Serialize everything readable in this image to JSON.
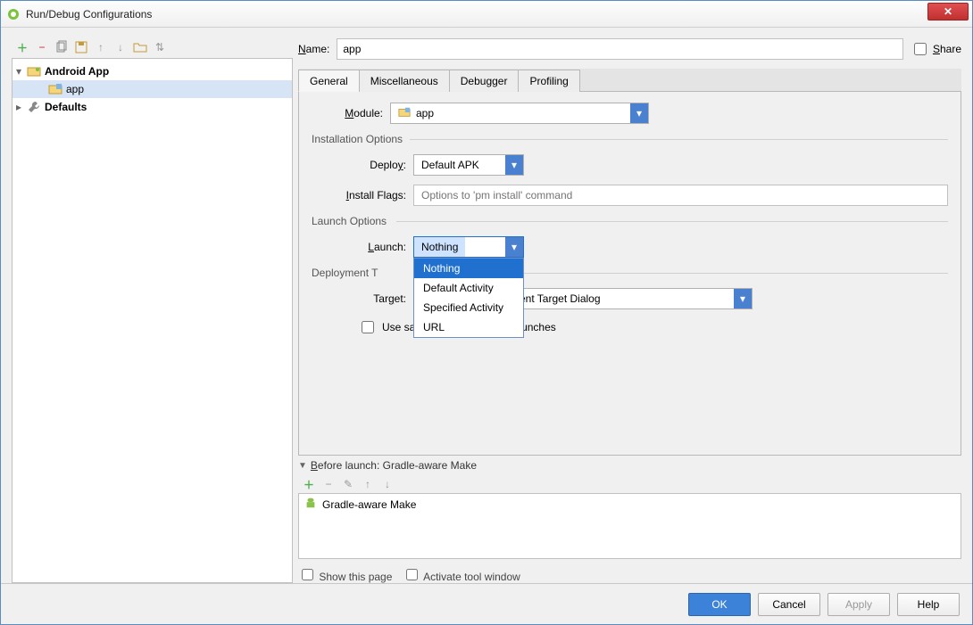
{
  "window": {
    "title": "Run/Debug Configurations"
  },
  "toolbar_icons": [
    "add",
    "remove",
    "copy",
    "save",
    "up",
    "down",
    "folder",
    "sort"
  ],
  "tree": {
    "nodes": [
      {
        "label": "Android App",
        "depth": 0,
        "bold": true,
        "expander": "▾",
        "icon": "android-app"
      },
      {
        "label": "app",
        "depth": 1,
        "bold": false,
        "expander": "",
        "icon": "module"
      },
      {
        "label": "Defaults",
        "depth": 0,
        "bold": true,
        "expander": "▸",
        "icon": "wrench"
      }
    ]
  },
  "name": {
    "label": "Name:",
    "value": "app"
  },
  "share_label": "Share",
  "tabs": [
    "General",
    "Miscellaneous",
    "Debugger",
    "Profiling"
  ],
  "module": {
    "label": "Module:",
    "value": "app"
  },
  "install": {
    "section_label": "Installation Options",
    "deploy_label": "Deploy:",
    "deploy_value": "Default APK",
    "flags_label": "Install Flags:",
    "flags_placeholder": "Options to 'pm install' command"
  },
  "launch": {
    "section_label": "Launch Options",
    "label": "Launch:",
    "value": "Nothing",
    "options": [
      "Nothing",
      "Default Activity",
      "Specified Activity",
      "URL"
    ]
  },
  "deploy_target": {
    "section_label": "Deployment Target Options",
    "target_label": "Target:",
    "target_value_suffix": "ent Target Dialog",
    "same_device_label": "Use same device for future launches"
  },
  "before_launch": {
    "header": "Before launch: Gradle-aware Make",
    "item": "Gradle-aware Make"
  },
  "bottom": {
    "show_page": "Show this page",
    "activate_tool": "Activate tool window"
  },
  "buttons": {
    "ok": "OK",
    "cancel": "Cancel",
    "apply": "Apply",
    "help": "Help"
  }
}
